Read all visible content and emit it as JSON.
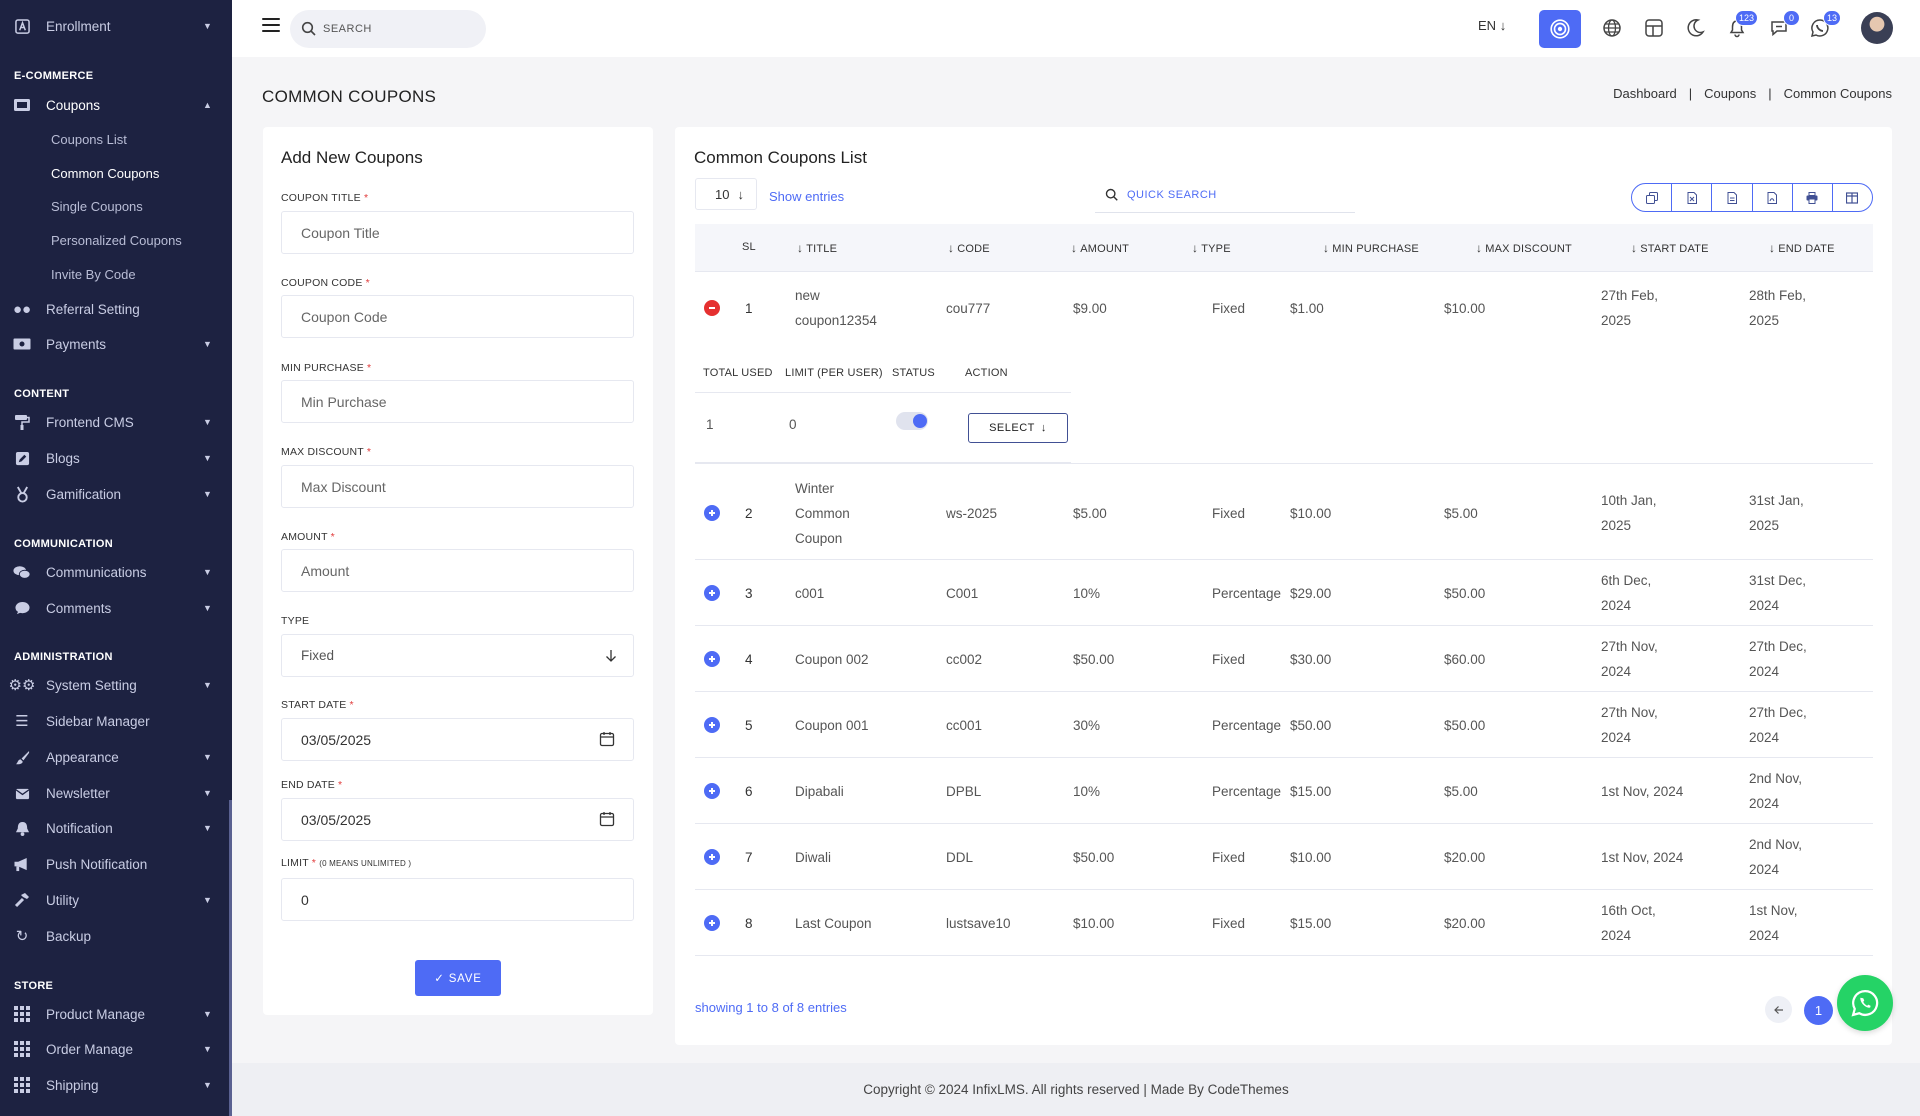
{
  "sidebar": {
    "top_item": "Enrollment",
    "sections": {
      "ecommerce": "E-COMMERCE",
      "content": "CONTENT",
      "communication": "COMMUNICATION",
      "administration": "ADMINISTRATION",
      "store": "STORE"
    },
    "coupons": "Coupons",
    "coupon_subs": [
      "Coupons List",
      "Common Coupons",
      "Single Coupons",
      "Personalized Coupons",
      "Invite By Code"
    ],
    "items": {
      "referral": "Referral Setting",
      "payments": "Payments",
      "frontend_cms": "Frontend CMS",
      "blogs": "Blogs",
      "gamification": "Gamification",
      "communications": "Communications",
      "comments": "Comments",
      "system_setting": "System Setting",
      "sidebar_manager": "Sidebar Manager",
      "appearance": "Appearance",
      "newsletter": "Newsletter",
      "notification": "Notification",
      "push_notification": "Push Notification",
      "utility": "Utility",
      "backup": "Backup",
      "product_manage": "Product Manage",
      "order_manage": "Order Manage",
      "shipping": "Shipping"
    }
  },
  "header": {
    "search_placeholder": "SEARCH",
    "language": "EN",
    "badges": {
      "notifications": "123",
      "messages": "0",
      "whatsapp": "13"
    },
    "icons": [
      "menu-icon",
      "search-icon",
      "dashboard-icon",
      "globe-icon",
      "layout-icon",
      "moon-icon",
      "bell-icon",
      "chat-icon",
      "whatsapp-icon"
    ]
  },
  "page": {
    "title": "COMMON COUPONS",
    "breadcrumb": [
      "Dashboard",
      "Coupons",
      "Common Coupons"
    ]
  },
  "form": {
    "title": "Add New Coupons",
    "coupon_title_label": "COUPON TITLE",
    "coupon_title_placeholder": "Coupon Title",
    "coupon_code_label": "COUPON CODE",
    "coupon_code_placeholder": "Coupon Code",
    "min_purchase_label": "MIN PURCHASE",
    "min_purchase_placeholder": "Min Purchase",
    "max_discount_label": "MAX DISCOUNT",
    "max_discount_placeholder": "Max Discount",
    "amount_label": "AMOUNT",
    "amount_placeholder": "Amount",
    "type_label": "TYPE",
    "type_value": "Fixed",
    "start_date_label": "START DATE",
    "start_date_value": "03/05/2025",
    "end_date_label": "END DATE",
    "end_date_value": "03/05/2025",
    "limit_label": "LIMIT",
    "limit_note": "(0 MEANS UNLIMITED )",
    "limit_value": "0",
    "save_label": "SAVE"
  },
  "list": {
    "title": "Common Coupons List",
    "entries_value": "10",
    "entries_label": "Show entries",
    "quick_search_placeholder": "QUICK SEARCH",
    "columns": [
      "SL",
      "TITLE",
      "CODE",
      "AMOUNT",
      "TYPE",
      "MIN PURCHASE",
      "MAX DISCOUNT",
      "START DATE",
      "END DATE"
    ],
    "child_columns": [
      "TOTAL USED",
      "LIMIT (PER USER)",
      "STATUS",
      "ACTION"
    ],
    "child_values": {
      "total_used": "1",
      "limit": "0",
      "status_on": true,
      "action": "SELECT"
    },
    "rows": [
      {
        "sl": "1",
        "title": [
          "new",
          "coupon12354"
        ],
        "code": "cou777",
        "amount": "$9.00",
        "type": "Fixed",
        "min": "$1.00",
        "max": "$10.00",
        "start": [
          "27th Feb,",
          "2025"
        ],
        "end": [
          "28th Feb,",
          "2025"
        ]
      },
      {
        "sl": "2",
        "title": [
          "Winter",
          "Common",
          "Coupon"
        ],
        "code": "ws-2025",
        "amount": "$5.00",
        "type": "Fixed",
        "min": "$10.00",
        "max": "$5.00",
        "start": [
          "10th Jan,",
          "2025"
        ],
        "end": [
          "31st Jan,",
          "2025"
        ]
      },
      {
        "sl": "3",
        "title": [
          "c001"
        ],
        "code": "C001",
        "amount": "10%",
        "type": "Percentage",
        "min": "$29.00",
        "max": "$50.00",
        "start": [
          "6th Dec,",
          "2024"
        ],
        "end": [
          "31st Dec,",
          "2024"
        ]
      },
      {
        "sl": "4",
        "title": [
          "Coupon 002"
        ],
        "code": "cc002",
        "amount": "$50.00",
        "type": "Fixed",
        "min": "$30.00",
        "max": "$60.00",
        "start": [
          "27th Nov,",
          "2024"
        ],
        "end": [
          "27th Dec,",
          "2024"
        ]
      },
      {
        "sl": "5",
        "title": [
          "Coupon 001"
        ],
        "code": "cc001",
        "amount": "30%",
        "type": "Percentage",
        "min": "$50.00",
        "max": "$50.00",
        "start": [
          "27th Nov,",
          "2024"
        ],
        "end": [
          "27th Dec,",
          "2024"
        ]
      },
      {
        "sl": "6",
        "title": [
          "Dipabali"
        ],
        "code": "DPBL",
        "amount": "10%",
        "type": "Percentage",
        "min": "$15.00",
        "max": "$5.00",
        "start": [
          "1st Nov, 2024"
        ],
        "end": [
          "2nd Nov,",
          "2024"
        ]
      },
      {
        "sl": "7",
        "title": [
          "Diwali"
        ],
        "code": "DDL",
        "amount": "$50.00",
        "type": "Fixed",
        "min": "$10.00",
        "max": "$20.00",
        "start": [
          "1st Nov, 2024"
        ],
        "end": [
          "2nd Nov,",
          "2024"
        ]
      },
      {
        "sl": "8",
        "title": [
          "Last Coupon"
        ],
        "code": "lustsave10",
        "amount": "$10.00",
        "type": "Fixed",
        "min": "$15.00",
        "max": "$20.00",
        "start": [
          "16th Oct,",
          "2024"
        ],
        "end": [
          "1st Nov,",
          "2024"
        ]
      }
    ],
    "showing": "showing 1 to 8 of 8 entries",
    "page_number": "1"
  },
  "footer": "Copyright © 2024 InfixLMS. All rights reserved | Made By CodeThemes",
  "colors": {
    "accent": "#4e6bf5",
    "sidebar": "#1d2241",
    "danger": "#e53030",
    "whatsapp": "#25d366"
  }
}
